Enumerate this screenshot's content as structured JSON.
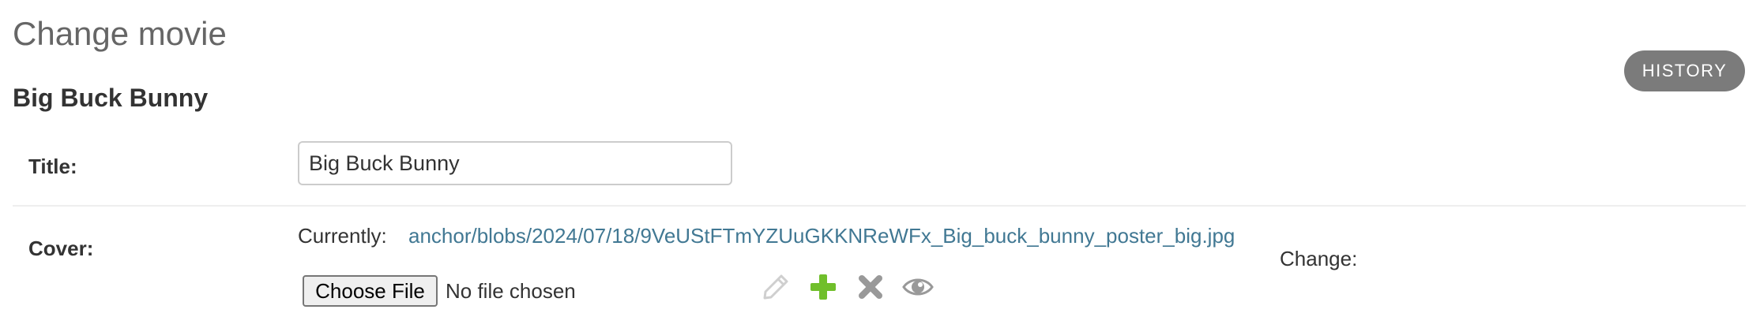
{
  "header": {
    "page_title": "Change movie",
    "object_title": "Big Buck Bunny",
    "history_label": "HISTORY"
  },
  "form": {
    "title": {
      "label": "Title:",
      "value": "Big Buck Bunny"
    },
    "cover": {
      "label": "Cover:",
      "currently_label": "Currently:",
      "current_file": "anchor/blobs/2024/07/18/9VeUStFTmYZUuGKKNReWFx_Big_buck_bunny_poster_big.jpg",
      "change_label": "Change:",
      "choose_file_label": "Choose File",
      "no_file_text": "No file chosen",
      "related_icons": [
        "pencil-icon",
        "plus-icon",
        "x-icon",
        "eye-icon"
      ]
    }
  },
  "colors": {
    "link": "#417893",
    "history_bg": "#7b7b7b",
    "add_icon": "#70bf2b",
    "muted_icon": "#999999"
  }
}
